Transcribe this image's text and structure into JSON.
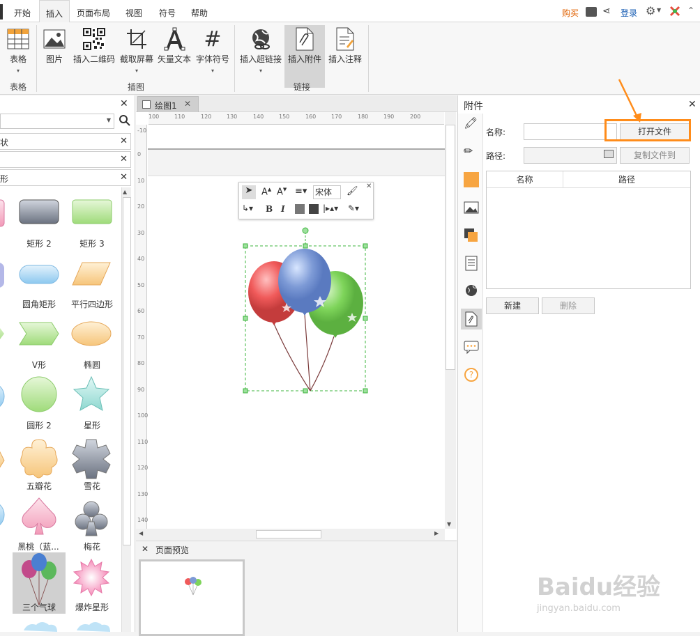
{
  "menu": {
    "tabs": [
      "开始",
      "插入",
      "页面布局",
      "视图",
      "符号",
      "帮助"
    ],
    "buy": "购买",
    "login": "登录"
  },
  "ribbon": {
    "table": "表格",
    "picture": "图片",
    "qrcode": "插入二维码",
    "screenshot": "截取屏幕",
    "vector_text": "矢量文本",
    "font_symbol": "字体符号",
    "hyperlink": "插入超链接",
    "attachment": "插入附件",
    "comment": "插入注释",
    "groups": {
      "table": "表格",
      "illustration": "插图",
      "link": "链接"
    }
  },
  "library": {
    "section1": "状",
    "section3": "形",
    "shapes": [
      {
        "label": "矩形 2"
      },
      {
        "label": "矩形 3"
      },
      {
        "label": "圆角矩形"
      },
      {
        "label": "平行四边形"
      },
      {
        "label": "V形"
      },
      {
        "label": "椭圆"
      },
      {
        "label": "圆形 2"
      },
      {
        "label": "星形"
      },
      {
        "label": "五瓣花"
      },
      {
        "label": "雪花"
      },
      {
        "label": "黑桃（蓝..."
      },
      {
        "label": "梅花"
      },
      {
        "label": "三个气球"
      },
      {
        "label": "爆炸星形"
      }
    ]
  },
  "document": {
    "tab_title": "绘图1",
    "ruler_top": [
      "100",
      "110",
      "120",
      "130",
      "140",
      "150",
      "160",
      "170",
      "180",
      "190",
      "200"
    ],
    "ruler_left": [
      "-10",
      "0",
      "10",
      "20",
      "30",
      "40",
      "50",
      "60",
      "70",
      "80",
      "90",
      "100",
      "110",
      "120",
      "130",
      "140"
    ],
    "font_name": "宋体",
    "bold": "B",
    "italic": "I"
  },
  "preview": {
    "title": "页面预览"
  },
  "attachment_panel": {
    "title": "附件",
    "name_label": "名称:",
    "path_label": "路径:",
    "open_file": "打开文件",
    "copy_file_to": "复制文件到",
    "col_name": "名称",
    "col_path": "路径",
    "new_button": "新建",
    "delete_button": "删除"
  },
  "watermark": {
    "brand": "Baidu经验",
    "url": "jingyan.baidu.com"
  },
  "colors": {
    "highlight": "#ff8c1a",
    "accent_orange": "#f7a541",
    "link_blue": "#1a5fb4"
  }
}
